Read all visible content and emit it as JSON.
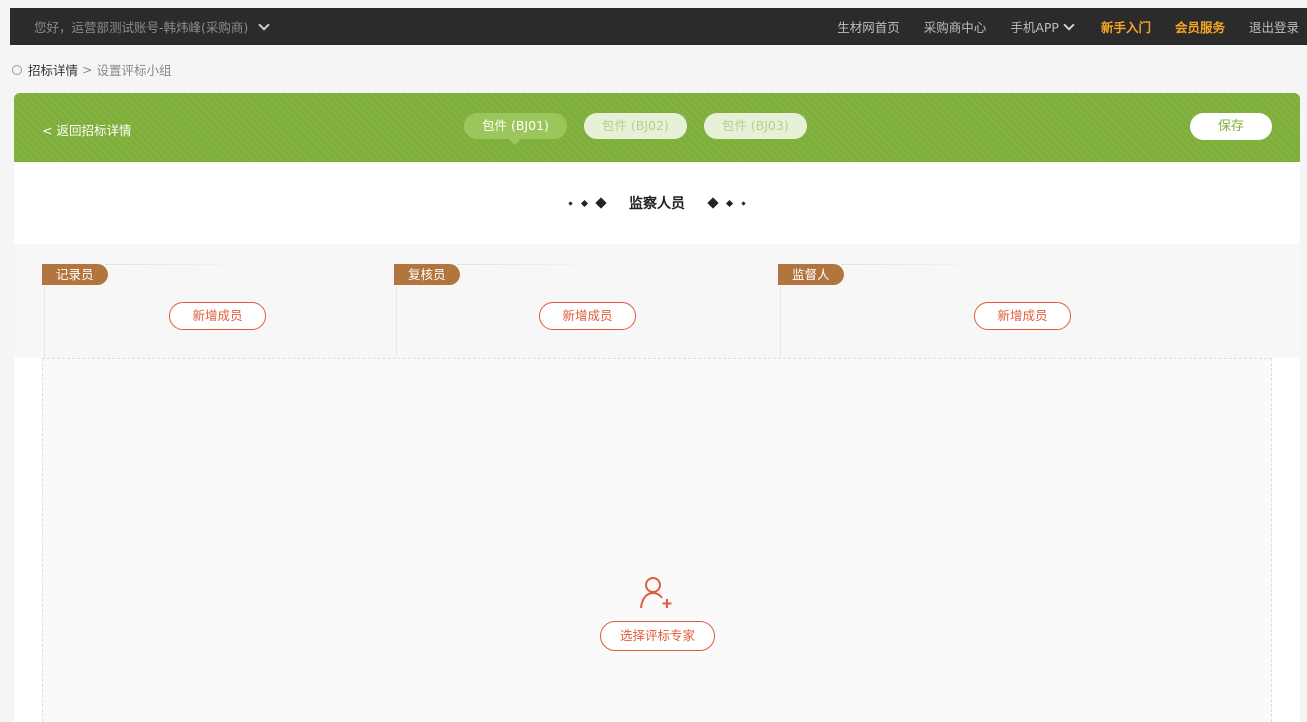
{
  "topbar": {
    "greeting": "您好，运营部测试账号-韩炜峰(采购商)",
    "nav": [
      {
        "label": "生材网首页",
        "highlight": false,
        "dropdown": false
      },
      {
        "label": "采购商中心",
        "highlight": false,
        "dropdown": false
      },
      {
        "label": "手机APP",
        "highlight": false,
        "dropdown": true
      },
      {
        "label": "新手入门",
        "highlight": true,
        "dropdown": false
      },
      {
        "label": "会员服务",
        "highlight": true,
        "dropdown": false
      },
      {
        "label": "退出登录",
        "highlight": false,
        "dropdown": false
      }
    ]
  },
  "breadcrumb": {
    "root": "招标详情",
    "separator": ">",
    "current": "设置评标小组"
  },
  "header": {
    "back_label": "< 返回招标详情",
    "tabs": [
      {
        "label": "包件 (BJ01)",
        "active": true
      },
      {
        "label": "包件 (BJ02)",
        "active": false
      },
      {
        "label": "包件 (BJ03)",
        "active": false
      }
    ],
    "save_label": "保存"
  },
  "section": {
    "title": "监察人员"
  },
  "roles": [
    {
      "label": "记录员",
      "button": "新增成员"
    },
    {
      "label": "复核员",
      "button": "新增成员"
    },
    {
      "label": "监督人",
      "button": "新增成员"
    }
  ],
  "experts": {
    "button_label": "选择评标专家",
    "icon": "add-user-icon"
  },
  "colors": {
    "topbar_bg": "#2b2b2b",
    "accent_green": "#7eaf3a",
    "accent_orange": "#f6a623",
    "action_red": "#e25c3a",
    "role_tag": "#b3753e"
  }
}
